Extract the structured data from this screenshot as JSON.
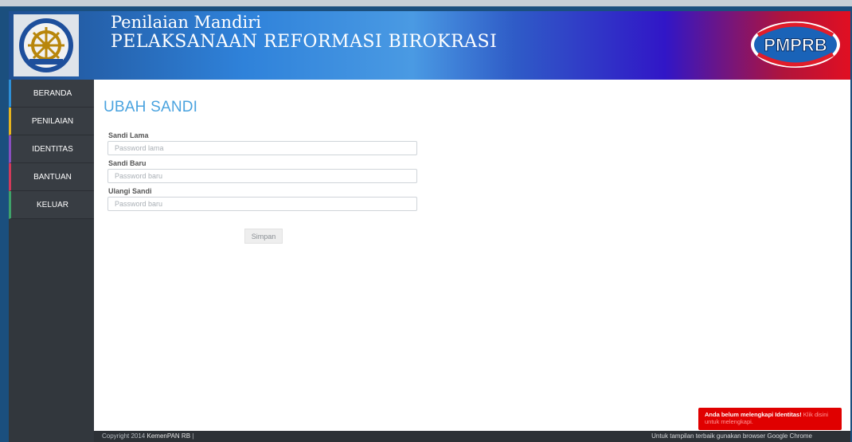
{
  "header": {
    "title_line1": "Penilaian Mandiri",
    "title_line2": "PELAKSANAAN REFORMASI BIROKRASI",
    "brand_logo_text": "PMPRB",
    "emblem_icon": "ship-wheel-emblem-icon"
  },
  "sidebar": {
    "items": [
      {
        "label": "BERANDA"
      },
      {
        "label": "PENILAIAN"
      },
      {
        "label": "IDENTITAS"
      },
      {
        "label": "BANTUAN"
      },
      {
        "label": "KELUAR"
      }
    ]
  },
  "main": {
    "page_title": "UBAH SANDI",
    "form": {
      "old_label": "Sandi Lama",
      "old_placeholder": "Password lama",
      "new_label": "Sandi Baru",
      "new_placeholder": "Password baru",
      "repeat_label": "Ulangi Sandi",
      "repeat_placeholder": "Password baru",
      "submit_label": "Simpan"
    }
  },
  "footer": {
    "copyright": "Copyright 2014",
    "brand": "KemenPAN RB",
    "separator": "|",
    "note": "Untuk tampilan terbaik gunakan browser Google Chrome"
  },
  "alert": {
    "text": "Anda belum melengkapi Identitas!",
    "link": "Klik disini untuk melengkapi."
  },
  "colors": {
    "accent": "#4aa3df",
    "alert": "#e00000",
    "sidebar": "#32373d"
  }
}
